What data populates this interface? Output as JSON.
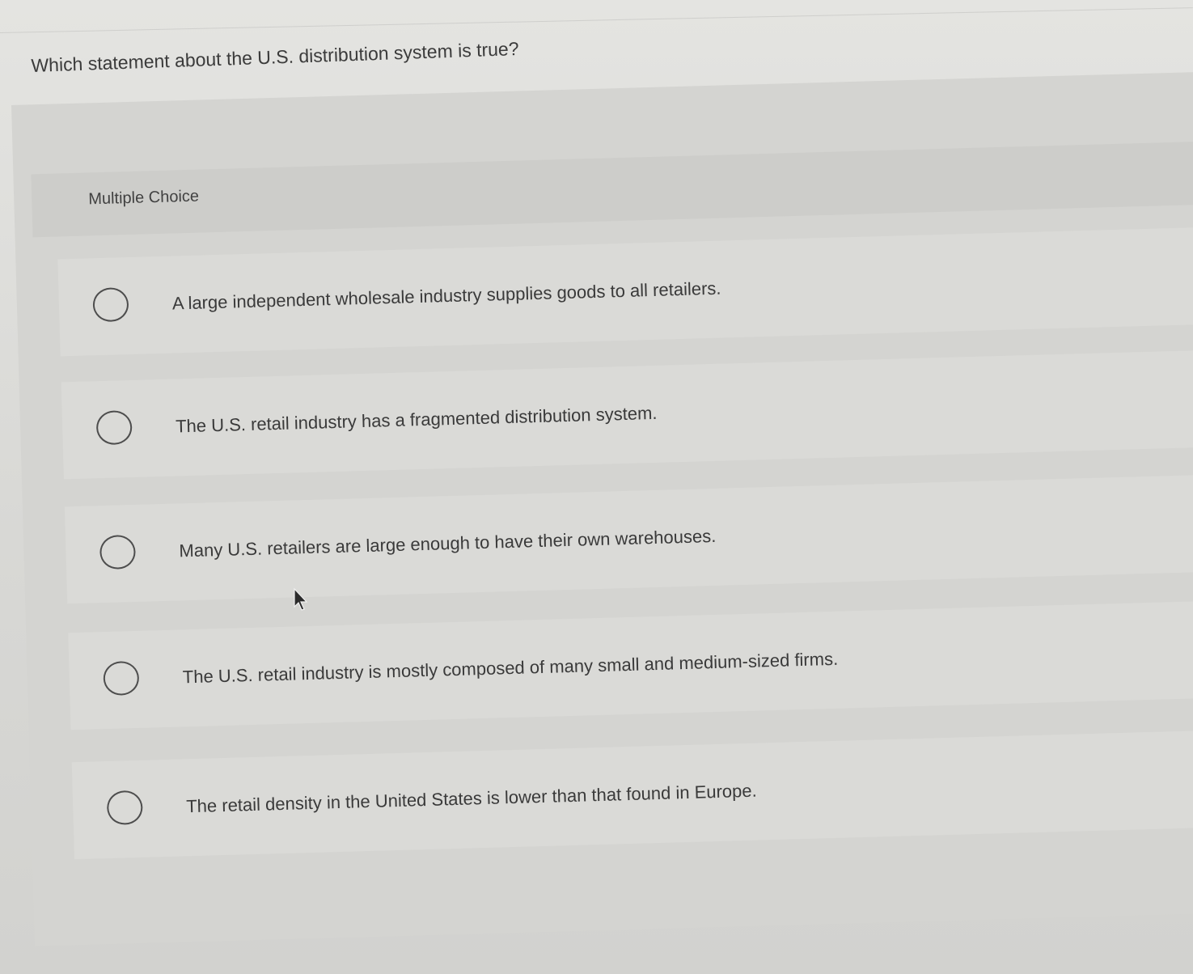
{
  "question": {
    "text": "Which statement about the U.S. distribution system is true?"
  },
  "section": {
    "label": "Multiple Choice"
  },
  "options": [
    {
      "label": "A large independent wholesale industry supplies goods to all retailers."
    },
    {
      "label": "The U.S. retail industry has a fragmented distribution system."
    },
    {
      "label": "Many U.S. retailers are large enough to have their own warehouses."
    },
    {
      "label": "The U.S. retail industry is mostly composed of many small and medium-sized firms."
    },
    {
      "label": "The retail density in the United States is lower than that found in Europe."
    }
  ],
  "icons": {
    "radio": "radio-unchecked-icon",
    "cursor": "mouse-pointer-icon"
  },
  "colors": {
    "background": "#d9d9d6",
    "text": "#3a3a3a",
    "radio_border": "#4d4d4d"
  }
}
